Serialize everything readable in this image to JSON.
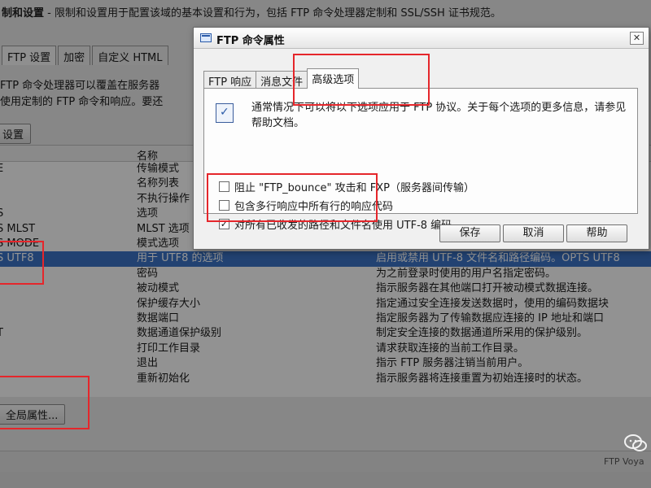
{
  "background": {
    "title_bold": "制和设置",
    "title_desc": " - 限制和设置用于配置该域的基本设置和行为，包括 FTP 命令处理器定制和 SSL/SSH 证书规范。",
    "tabs": [
      "FTP 设置",
      "加密",
      "自定义 HTML"
    ],
    "intro_lines": [
      "FTP 命令处理器可以覆盖在服务器",
      "使用定制的 FTP 命令和响应。要还"
    ],
    "settings_button": "设置",
    "table_header": {
      "col_name": "名称"
    },
    "rows": [
      {
        "c1": "E",
        "c2": "传输模式",
        "c3": ""
      },
      {
        "c1": "",
        "c2": "名称列表",
        "c3": ""
      },
      {
        "c1": "",
        "c2": "不执行操作",
        "c3": ""
      },
      {
        "c1": "S",
        "c2": "选项",
        "c3": ""
      },
      {
        "c1": "S MLST",
        "c2": "MLST 选项",
        "c3": ""
      },
      {
        "c1": "S MODE",
        "c2": "模式选项",
        "c3": ""
      },
      {
        "c1": "S UTF8",
        "c2": "用于 UTF8 的选项",
        "c3": "启用或禁用 UTF-8 文件名和路径编码。OPTS UTF8"
      },
      {
        "c1": "",
        "c2": "密码",
        "c3": "为之前登录时使用的用户名指定密码。"
      },
      {
        "c1": "",
        "c2": "被动模式",
        "c3": "指示服务器在其他端口打开被动模式数据连接。"
      },
      {
        "c1": "",
        "c2": "保护缓存大小",
        "c3": "指定通过安全连接发送数据时，使用的编码数据块"
      },
      {
        "c1": "",
        "c2": "数据端口",
        "c3": "指定服务器为了传输数据应连接的 IP 地址和端口"
      },
      {
        "c1": "T",
        "c2": "数据通道保护级别",
        "c3": "制定安全连接的数据通道所采用的保护级别。"
      },
      {
        "c1": "",
        "c2": "打印工作目录",
        "c3": "请求获取连接的当前工作目录。"
      },
      {
        "c1": "",
        "c2": "退出",
        "c3": "指示 FTP 服务器注销当前用户。"
      },
      {
        "c1": "",
        "c2": "重新初始化",
        "c3": "指示服务器将连接重置为初始连接时的状态。"
      }
    ],
    "global_button": "全局属性...",
    "status_text": "FTP Voya"
  },
  "dialog": {
    "title": "FTP 命令属性",
    "close_glyph": "✕",
    "tabs": [
      "FTP 响应",
      "消息文件",
      "高级选项"
    ],
    "info_text": "通常情况下可以将以下选项应用于 FTP 协议。关于每个选项的更多信息，请参见帮助文档。",
    "options": [
      {
        "label": "阻止 \"FTP_bounce\" 攻击和 FXP（服务器间传输）",
        "checked": false
      },
      {
        "label": "包含多行响应中所有行的响应代码",
        "checked": false
      },
      {
        "label": "对所有已收发的路径和文件名使用 UTF-8 编码",
        "checked": true
      }
    ],
    "buttons": {
      "save": "保存",
      "cancel": "取消",
      "help": "帮助"
    }
  },
  "watermark_icon": "wechat-icon",
  "annotation_color": "#e5262b"
}
